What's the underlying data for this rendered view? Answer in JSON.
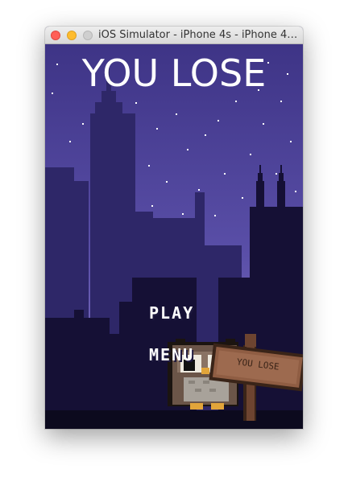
{
  "window": {
    "title": "iOS Simulator - iPhone 4s - iPhone 4s...",
    "lights": {
      "close": "#ff5f57",
      "minimize": "#febc2e",
      "zoom": "#c8c8c8"
    }
  },
  "game": {
    "heading": "YOU LOSE",
    "menu": {
      "play_label": "PLAY",
      "menu_label": "MENU"
    },
    "sign_text": "YOU LOSE",
    "colors": {
      "sky_top": "#3e3486",
      "sky_bottom": "#8a7bcb",
      "far_buildings": "#2e2768",
      "near_buildings": "#151035",
      "ground": "#0c0a1e"
    }
  }
}
